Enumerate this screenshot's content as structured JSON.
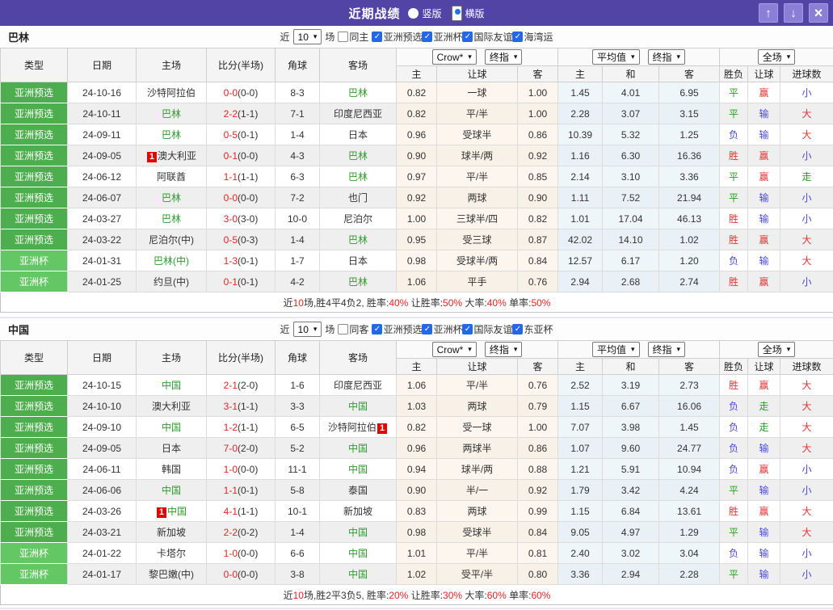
{
  "titlebar": {
    "title": "近期战绩",
    "radio_vertical": "竖版",
    "radio_horizontal": "横版",
    "up_icon": "↑",
    "down_icon": "↓",
    "close_icon": "×"
  },
  "columns": {
    "type": "类型",
    "date": "日期",
    "home": "主场",
    "score": "比分(半场)",
    "corner": "角球",
    "away": "客场",
    "g1_select1": "Crow*",
    "g1_select2": "终指",
    "g2_select1": "平均值",
    "g2_select2": "终指",
    "g3_select": "全场",
    "sub_home1": "主",
    "sub_handicap1": "让球",
    "sub_away1": "客",
    "sub_home2": "主",
    "sub_draw": "和",
    "sub_away2": "客",
    "res_wdl": "胜负",
    "res_handicap": "让球",
    "res_goals": "进球数"
  },
  "sections": [
    {
      "team": "巴林",
      "filter": {
        "prefix": "近",
        "count": "10",
        "suffix": "场",
        "same": {
          "label": "同主",
          "checked": false
        },
        "comps": [
          {
            "label": "亚洲预选",
            "checked": true
          },
          {
            "label": "亚洲杯",
            "checked": true
          },
          {
            "label": "国际友谊",
            "checked": true
          },
          {
            "label": "海湾运",
            "checked": true
          }
        ]
      },
      "rows": [
        {
          "type": "亚洲预选",
          "tier": "pre",
          "date": "24-10-16",
          "home": {
            "name": "沙特阿拉伯",
            "green": false
          },
          "score": "0-0",
          "half": "(0-0)",
          "corner": "8-3",
          "away": {
            "name": "巴林",
            "green": true
          },
          "odds1": [
            "0.82",
            "一球",
            "1.00"
          ],
          "odds2": [
            "1.45",
            "4.01",
            "6.95"
          ],
          "results": [
            {
              "t": "平",
              "c": "g"
            },
            {
              "t": "赢",
              "c": "r"
            },
            {
              "t": "小",
              "c": "b"
            }
          ]
        },
        {
          "type": "亚洲预选",
          "tier": "pre",
          "date": "24-10-11",
          "home": {
            "name": "巴林",
            "green": true
          },
          "score": "2-2",
          "half": "(1-1)",
          "corner": "7-1",
          "away": {
            "name": "印度尼西亚",
            "green": false
          },
          "odds1": [
            "0.82",
            "平/半",
            "1.00"
          ],
          "odds2": [
            "2.28",
            "3.07",
            "3.15"
          ],
          "results": [
            {
              "t": "平",
              "c": "g"
            },
            {
              "t": "输",
              "c": "b"
            },
            {
              "t": "大",
              "c": "r"
            }
          ]
        },
        {
          "type": "亚洲预选",
          "tier": "pre",
          "date": "24-09-11",
          "home": {
            "name": "巴林",
            "green": true
          },
          "score": "0-5",
          "half": "(0-1)",
          "corner": "1-4",
          "away": {
            "name": "日本",
            "green": false
          },
          "odds1": [
            "0.96",
            "受球半",
            "0.86"
          ],
          "odds2": [
            "10.39",
            "5.32",
            "1.25"
          ],
          "results": [
            {
              "t": "负",
              "c": "b"
            },
            {
              "t": "输",
              "c": "b"
            },
            {
              "t": "大",
              "c": "r"
            }
          ]
        },
        {
          "type": "亚洲预选",
          "tier": "pre",
          "date": "24-09-05",
          "home": {
            "name": "澳大利亚",
            "green": false,
            "badge": "1",
            "badge_pos": "before"
          },
          "score": "0-1",
          "half": "(0-0)",
          "corner": "4-3",
          "away": {
            "name": "巴林",
            "green": true
          },
          "odds1": [
            "0.90",
            "球半/两",
            "0.92"
          ],
          "odds2": [
            "1.16",
            "6.30",
            "16.36"
          ],
          "results": [
            {
              "t": "胜",
              "c": "r"
            },
            {
              "t": "赢",
              "c": "r"
            },
            {
              "t": "小",
              "c": "b"
            }
          ]
        },
        {
          "type": "亚洲预选",
          "tier": "pre",
          "date": "24-06-12",
          "home": {
            "name": "阿联酋",
            "green": false
          },
          "score": "1-1",
          "half": "(1-1)",
          "corner": "6-3",
          "away": {
            "name": "巴林",
            "green": true
          },
          "odds1": [
            "0.97",
            "平/半",
            "0.85"
          ],
          "odds2": [
            "2.14",
            "3.10",
            "3.36"
          ],
          "results": [
            {
              "t": "平",
              "c": "g"
            },
            {
              "t": "赢",
              "c": "r"
            },
            {
              "t": "走",
              "c": "g"
            }
          ]
        },
        {
          "type": "亚洲预选",
          "tier": "pre",
          "date": "24-06-07",
          "home": {
            "name": "巴林",
            "green": true
          },
          "score": "0-0",
          "half": "(0-0)",
          "corner": "7-2",
          "away": {
            "name": "也门",
            "green": false
          },
          "odds1": [
            "0.92",
            "两球",
            "0.90"
          ],
          "odds2": [
            "1.11",
            "7.52",
            "21.94"
          ],
          "results": [
            {
              "t": "平",
              "c": "g"
            },
            {
              "t": "输",
              "c": "b"
            },
            {
              "t": "小",
              "c": "b"
            }
          ]
        },
        {
          "type": "亚洲预选",
          "tier": "pre",
          "date": "24-03-27",
          "home": {
            "name": "巴林",
            "green": true
          },
          "score": "3-0",
          "half": "(3-0)",
          "corner": "10-0",
          "away": {
            "name": "尼泊尔",
            "green": false
          },
          "odds1": [
            "1.00",
            "三球半/四",
            "0.82"
          ],
          "odds2": [
            "1.01",
            "17.04",
            "46.13"
          ],
          "results": [
            {
              "t": "胜",
              "c": "r"
            },
            {
              "t": "输",
              "c": "b"
            },
            {
              "t": "小",
              "c": "b"
            }
          ]
        },
        {
          "type": "亚洲预选",
          "tier": "pre",
          "date": "24-03-22",
          "home": {
            "name": "尼泊尔(中)",
            "green": false
          },
          "score": "0-5",
          "half": "(0-3)",
          "corner": "1-4",
          "away": {
            "name": "巴林",
            "green": true
          },
          "odds1": [
            "0.95",
            "受三球",
            "0.87"
          ],
          "odds2": [
            "42.02",
            "14.10",
            "1.02"
          ],
          "results": [
            {
              "t": "胜",
              "c": "r"
            },
            {
              "t": "赢",
              "c": "r"
            },
            {
              "t": "大",
              "c": "r"
            }
          ]
        },
        {
          "type": "亚洲杯",
          "tier": "cup",
          "date": "24-01-31",
          "home": {
            "name": "巴林(中)",
            "green": true
          },
          "score": "1-3",
          "half": "(0-1)",
          "corner": "1-7",
          "away": {
            "name": "日本",
            "green": false
          },
          "odds1": [
            "0.98",
            "受球半/两",
            "0.84"
          ],
          "odds2": [
            "12.57",
            "6.17",
            "1.20"
          ],
          "results": [
            {
              "t": "负",
              "c": "b"
            },
            {
              "t": "输",
              "c": "b"
            },
            {
              "t": "大",
              "c": "r"
            }
          ]
        },
        {
          "type": "亚洲杯",
          "tier": "cup",
          "date": "24-01-25",
          "home": {
            "name": "约旦(中)",
            "green": false
          },
          "score": "0-1",
          "half": "(0-1)",
          "corner": "4-2",
          "away": {
            "name": "巴林",
            "green": true
          },
          "odds1": [
            "1.06",
            "平手",
            "0.76"
          ],
          "odds2": [
            "2.94",
            "2.68",
            "2.74"
          ],
          "results": [
            {
              "t": "胜",
              "c": "r"
            },
            {
              "t": "赢",
              "c": "r"
            },
            {
              "t": "小",
              "c": "b"
            }
          ]
        }
      ],
      "summary": [
        {
          "t": "近",
          "red": false
        },
        {
          "t": "10",
          "red": true
        },
        {
          "t": "场,胜4平4负2, 胜率:",
          "red": false
        },
        {
          "t": "40%",
          "red": true
        },
        {
          "t": " 让胜率:",
          "red": false
        },
        {
          "t": "50%",
          "red": true
        },
        {
          "t": " 大率:",
          "red": false
        },
        {
          "t": "40%",
          "red": true
        },
        {
          "t": " 单率:",
          "red": false
        },
        {
          "t": "50%",
          "red": true
        }
      ]
    },
    {
      "team": "中国",
      "filter": {
        "prefix": "近",
        "count": "10",
        "suffix": "场",
        "same": {
          "label": "同客",
          "checked": false
        },
        "comps": [
          {
            "label": "亚洲预选",
            "checked": true
          },
          {
            "label": "亚洲杯",
            "checked": true
          },
          {
            "label": "国际友谊",
            "checked": true
          },
          {
            "label": "东亚杯",
            "checked": true
          }
        ]
      },
      "rows": [
        {
          "type": "亚洲预选",
          "tier": "pre",
          "date": "24-10-15",
          "home": {
            "name": "中国",
            "green": true
          },
          "score": "2-1",
          "half": "(2-0)",
          "corner": "1-6",
          "away": {
            "name": "印度尼西亚",
            "green": false
          },
          "odds1": [
            "1.06",
            "平/半",
            "0.76"
          ],
          "odds2": [
            "2.52",
            "3.19",
            "2.73"
          ],
          "results": [
            {
              "t": "胜",
              "c": "r"
            },
            {
              "t": "赢",
              "c": "r"
            },
            {
              "t": "大",
              "c": "r"
            }
          ]
        },
        {
          "type": "亚洲预选",
          "tier": "pre",
          "date": "24-10-10",
          "home": {
            "name": "澳大利亚",
            "green": false
          },
          "score": "3-1",
          "half": "(1-1)",
          "corner": "3-3",
          "away": {
            "name": "中国",
            "green": true
          },
          "odds1": [
            "1.03",
            "两球",
            "0.79"
          ],
          "odds2": [
            "1.15",
            "6.67",
            "16.06"
          ],
          "results": [
            {
              "t": "负",
              "c": "b"
            },
            {
              "t": "走",
              "c": "g"
            },
            {
              "t": "大",
              "c": "r"
            }
          ]
        },
        {
          "type": "亚洲预选",
          "tier": "pre",
          "date": "24-09-10",
          "home": {
            "name": "中国",
            "green": true
          },
          "score": "1-2",
          "half": "(1-1)",
          "corner": "6-5",
          "away": {
            "name": "沙特阿拉伯",
            "green": false,
            "badge": "1",
            "badge_pos": "after"
          },
          "odds1": [
            "0.82",
            "受一球",
            "1.00"
          ],
          "odds2": [
            "7.07",
            "3.98",
            "1.45"
          ],
          "results": [
            {
              "t": "负",
              "c": "b"
            },
            {
              "t": "走",
              "c": "g"
            },
            {
              "t": "大",
              "c": "r"
            }
          ]
        },
        {
          "type": "亚洲预选",
          "tier": "pre",
          "date": "24-09-05",
          "home": {
            "name": "日本",
            "green": false
          },
          "score": "7-0",
          "half": "(2-0)",
          "corner": "5-2",
          "away": {
            "name": "中国",
            "green": true
          },
          "odds1": [
            "0.96",
            "两球半",
            "0.86"
          ],
          "odds2": [
            "1.07",
            "9.60",
            "24.77"
          ],
          "results": [
            {
              "t": "负",
              "c": "b"
            },
            {
              "t": "输",
              "c": "b"
            },
            {
              "t": "大",
              "c": "r"
            }
          ]
        },
        {
          "type": "亚洲预选",
          "tier": "pre",
          "date": "24-06-11",
          "home": {
            "name": "韩国",
            "green": false
          },
          "score": "1-0",
          "half": "(0-0)",
          "corner": "11-1",
          "away": {
            "name": "中国",
            "green": true
          },
          "odds1": [
            "0.94",
            "球半/两",
            "0.88"
          ],
          "odds2": [
            "1.21",
            "5.91",
            "10.94"
          ],
          "results": [
            {
              "t": "负",
              "c": "b"
            },
            {
              "t": "赢",
              "c": "r"
            },
            {
              "t": "小",
              "c": "b"
            }
          ]
        },
        {
          "type": "亚洲预选",
          "tier": "pre",
          "date": "24-06-06",
          "home": {
            "name": "中国",
            "green": true
          },
          "score": "1-1",
          "half": "(0-1)",
          "corner": "5-8",
          "away": {
            "name": "泰国",
            "green": false
          },
          "odds1": [
            "0.90",
            "半/一",
            "0.92"
          ],
          "odds2": [
            "1.79",
            "3.42",
            "4.24"
          ],
          "results": [
            {
              "t": "平",
              "c": "g"
            },
            {
              "t": "输",
              "c": "b"
            },
            {
              "t": "小",
              "c": "b"
            }
          ]
        },
        {
          "type": "亚洲预选",
          "tier": "pre",
          "date": "24-03-26",
          "home": {
            "name": "中国",
            "green": true,
            "badge": "1",
            "badge_pos": "before"
          },
          "score": "4-1",
          "half": "(1-1)",
          "corner": "10-1",
          "away": {
            "name": "新加坡",
            "green": false
          },
          "odds1": [
            "0.83",
            "两球",
            "0.99"
          ],
          "odds2": [
            "1.15",
            "6.84",
            "13.61"
          ],
          "results": [
            {
              "t": "胜",
              "c": "r"
            },
            {
              "t": "赢",
              "c": "r"
            },
            {
              "t": "大",
              "c": "r"
            }
          ]
        },
        {
          "type": "亚洲预选",
          "tier": "pre",
          "date": "24-03-21",
          "home": {
            "name": "新加坡",
            "green": false
          },
          "score": "2-2",
          "half": "(0-2)",
          "corner": "1-4",
          "away": {
            "name": "中国",
            "green": true
          },
          "odds1": [
            "0.98",
            "受球半",
            "0.84"
          ],
          "odds2": [
            "9.05",
            "4.97",
            "1.29"
          ],
          "results": [
            {
              "t": "平",
              "c": "g"
            },
            {
              "t": "输",
              "c": "b"
            },
            {
              "t": "大",
              "c": "r"
            }
          ]
        },
        {
          "type": "亚洲杯",
          "tier": "cup",
          "date": "24-01-22",
          "home": {
            "name": "卡塔尔",
            "green": false
          },
          "score": "1-0",
          "half": "(0-0)",
          "corner": "6-6",
          "away": {
            "name": "中国",
            "green": true
          },
          "odds1": [
            "1.01",
            "平/半",
            "0.81"
          ],
          "odds2": [
            "2.40",
            "3.02",
            "3.04"
          ],
          "results": [
            {
              "t": "负",
              "c": "b"
            },
            {
              "t": "输",
              "c": "b"
            },
            {
              "t": "小",
              "c": "b"
            }
          ]
        },
        {
          "type": "亚洲杯",
          "tier": "cup",
          "date": "24-01-17",
          "home": {
            "name": "黎巴嫩(中)",
            "green": false
          },
          "score": "0-0",
          "half": "(0-0)",
          "corner": "3-8",
          "away": {
            "name": "中国",
            "green": true
          },
          "odds1": [
            "1.02",
            "受平/半",
            "0.80"
          ],
          "odds2": [
            "3.36",
            "2.94",
            "2.28"
          ],
          "results": [
            {
              "t": "平",
              "c": "g"
            },
            {
              "t": "输",
              "c": "b"
            },
            {
              "t": "小",
              "c": "b"
            }
          ]
        }
      ],
      "summary": [
        {
          "t": "近",
          "red": false
        },
        {
          "t": "10",
          "red": true
        },
        {
          "t": "场,胜2平3负5, 胜率:",
          "red": false
        },
        {
          "t": "20%",
          "red": true
        },
        {
          "t": " 让胜率:",
          "red": false
        },
        {
          "t": "30%",
          "red": true
        },
        {
          "t": " 大率:",
          "red": false
        },
        {
          "t": "60%",
          "red": true
        },
        {
          "t": " 单率:",
          "red": false
        },
        {
          "t": "60%",
          "red": true
        }
      ]
    }
  ]
}
